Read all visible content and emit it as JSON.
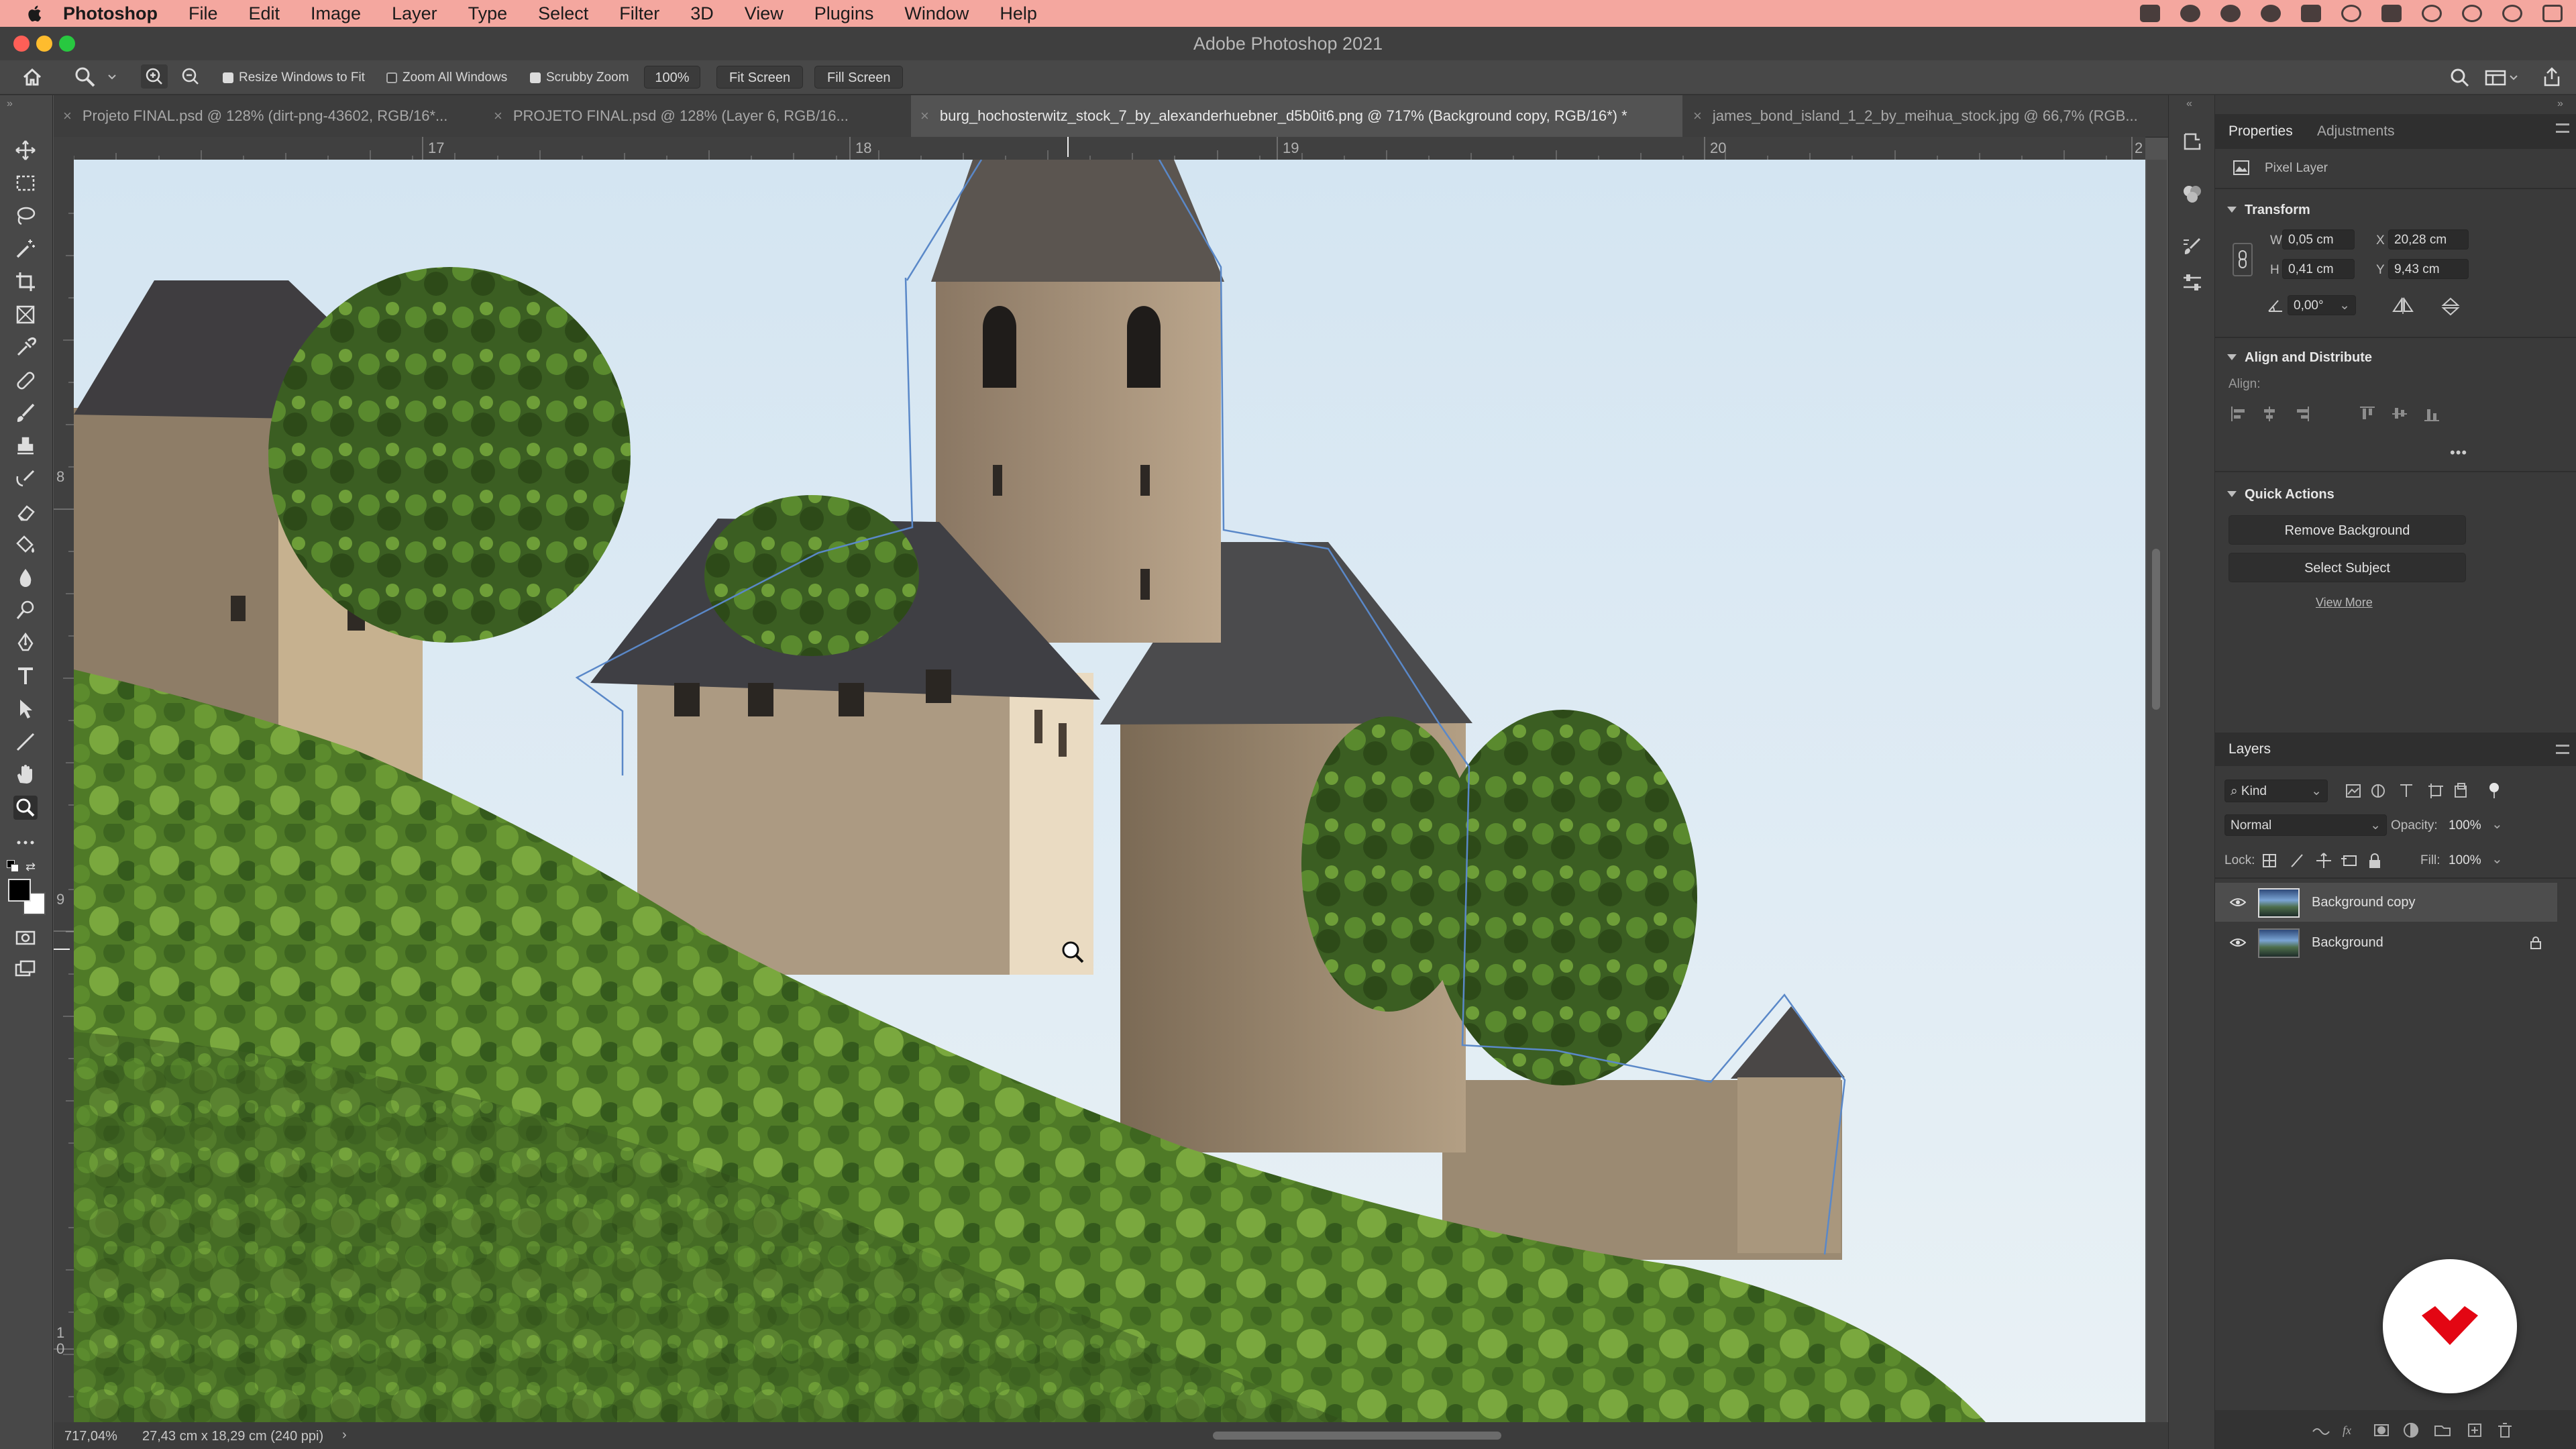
{
  "menubar": {
    "app": "Photoshop",
    "items": [
      "File",
      "Edit",
      "Image",
      "Layer",
      "Type",
      "Select",
      "Filter",
      "3D",
      "View",
      "Plugins",
      "Window",
      "Help"
    ]
  },
  "window": {
    "title": "Adobe Photoshop 2021"
  },
  "options_bar": {
    "resize_windows_to_fit": {
      "label": "Resize Windows to Fit",
      "checked": true
    },
    "zoom_all_windows": {
      "label": "Zoom All Windows",
      "checked": false
    },
    "scrubby_zoom": {
      "label": "Scrubby Zoom",
      "checked": true
    },
    "zoom_value": "100%",
    "fit_screen": "Fit Screen",
    "fill_screen": "Fill Screen"
  },
  "tabs": [
    {
      "label": "Projeto FINAL.psd @ 128% (dirt-png-43602, RGB/16*...",
      "active": false
    },
    {
      "label": "PROJETO FINAL.psd @ 128% (Layer 6, RGB/16...",
      "active": false
    },
    {
      "label": "burg_hochosterwitz_stock_7_by_alexanderhuebner_d5b0it6.png @ 717% (Background copy, RGB/16*) *",
      "active": true
    },
    {
      "label": "james_bond_island_1_2_by_meihua_stock.jpg @ 66,7% (RGB...",
      "active": false
    }
  ],
  "rulers": {
    "horizontal": [
      "17",
      "18",
      "19",
      "20",
      "2"
    ],
    "vertical": [
      "8",
      "9",
      "1",
      "0"
    ]
  },
  "status": {
    "zoom": "717,04%",
    "doc_size": "27,43 cm x 18,29 cm (240 ppi)"
  },
  "properties": {
    "tabs": [
      "Properties",
      "Adjustments"
    ],
    "layer_type": "Pixel Layer",
    "transform": {
      "title": "Transform",
      "w_label": "W",
      "w": "0,05 cm",
      "h_label": "H",
      "h": "0,41 cm",
      "x_label": "X",
      "x": "20,28 cm",
      "y_label": "Y",
      "y": "9,43 cm",
      "angle": "0,00°"
    },
    "align": {
      "title": "Align and Distribute",
      "label": "Align:"
    },
    "quick_actions": {
      "title": "Quick Actions",
      "remove_background": "Remove Background",
      "select_subject": "Select Subject",
      "view_more": "View More"
    }
  },
  "layers_panel": {
    "title": "Layers",
    "filter": "Kind",
    "blend_mode": "Normal",
    "opacity_label": "Opacity:",
    "opacity": "100%",
    "lock_label": "Lock:",
    "fill_label": "Fill:",
    "fill": "100%",
    "layers": [
      {
        "name": "Background copy",
        "selected": true,
        "locked": false
      },
      {
        "name": "Background",
        "selected": false,
        "locked": true
      }
    ]
  },
  "colors": {
    "menubar": "#f4a79f",
    "brand_logo": "#e30613"
  }
}
